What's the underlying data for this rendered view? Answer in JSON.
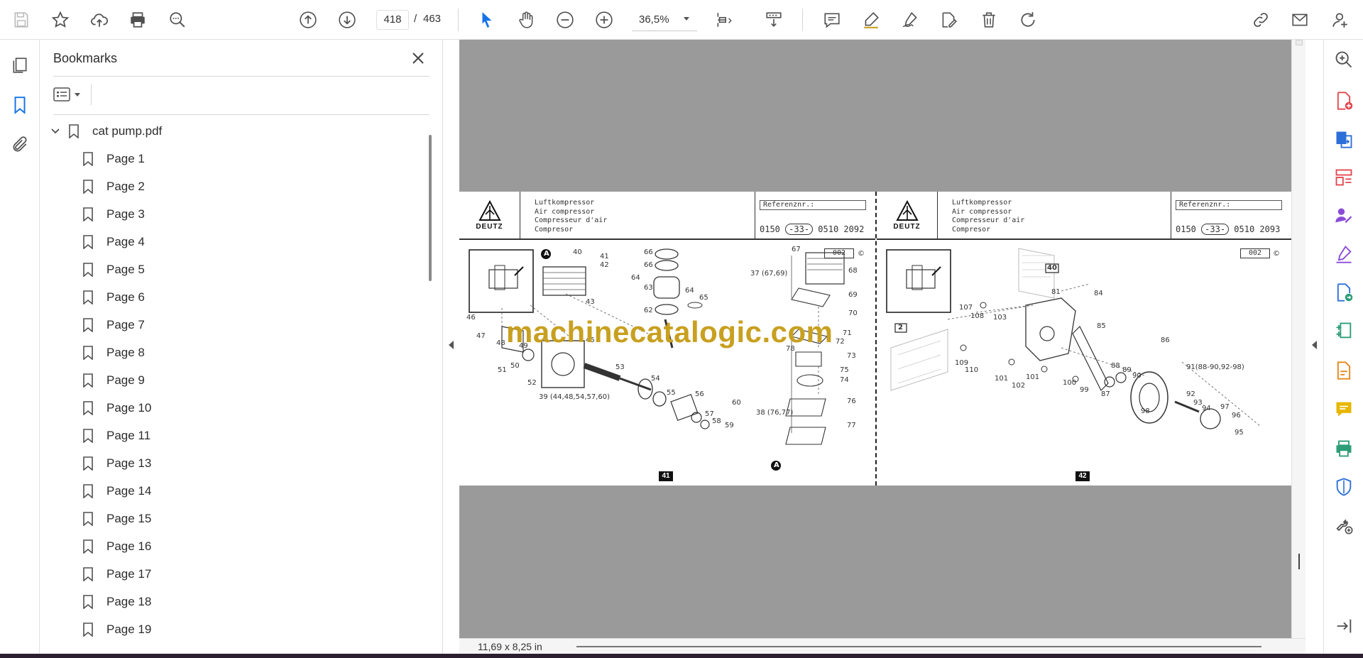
{
  "toolbar": {
    "page_current": "418",
    "page_separator": "/",
    "page_total": "463",
    "zoom": "36,5%",
    "icons": [
      "save-icon",
      "star-icon",
      "upload-icon",
      "print-icon",
      "search-zoom-icon",
      "prev-page-icon",
      "next-page-icon",
      "zoom-out-icon",
      "zoom-in-icon",
      "select-cursor-icon",
      "hand-icon",
      "fit-page-icon",
      "scroll-mode-icon",
      "comment-icon",
      "highlight-icon",
      "sign-icon",
      "edit-pdf-icon",
      "delete-icon",
      "rotate-icon",
      "share-link-icon",
      "email-icon",
      "account-icon"
    ]
  },
  "bookmarks": {
    "title": "Bookmarks",
    "root": "cat pump.pdf",
    "items": [
      "Page 1",
      "Page 2",
      "Page 3",
      "Page 4",
      "Page 5",
      "Page 6",
      "Page 7",
      "Page 8",
      "Page 9",
      "Page 10",
      "Page 11",
      "Page 13",
      "Page 14",
      "Page 15",
      "Page 16",
      "Page 17",
      "Page 18",
      "Page 19"
    ]
  },
  "document": {
    "left": {
      "brand": "DEUTZ",
      "titles": [
        "Luftkompressor",
        "Air compressor",
        "Compresseur d'air",
        "Compresor"
      ],
      "ref_label": "Referenznr.:",
      "ref_a": "0150",
      "ref_b": "-33-",
      "ref_c": "0510",
      "ref_d": "2092",
      "code": "002",
      "copyright": "©",
      "page_no": "41",
      "labels": [
        "40",
        "41",
        "42",
        "43",
        "45",
        "46",
        "47",
        "48",
        "49",
        "50",
        "51",
        "52",
        "53",
        "54",
        "55",
        "56",
        "57",
        "58",
        "59",
        "60",
        "62",
        "63",
        "64",
        "65",
        "66",
        "66",
        "64",
        "39 (44,48,54,57,60)",
        "67",
        "68",
        "69",
        "70",
        "71",
        "72",
        "73",
        "74",
        "75",
        "76",
        "77",
        "78",
        "37 (67,69)",
        "38 (76,77)",
        "A",
        "A"
      ]
    },
    "right": {
      "brand": "DEUTZ",
      "titles": [
        "Luftkompressor",
        "Air compressor",
        "Compresseur d'air",
        "Compresor"
      ],
      "ref_label": "Referenznr.:",
      "ref_a": "0150",
      "ref_b": "-33-",
      "ref_c": "0510",
      "ref_d": "2093",
      "code": "002",
      "copyright": "©",
      "page_no": "42",
      "labels": [
        "40",
        "2",
        "81",
        "84",
        "85",
        "86",
        "87",
        "88",
        "89",
        "90",
        "91(88-90,92-98)",
        "92",
        "93",
        "94",
        "95",
        "96",
        "97",
        "98",
        "99",
        "100",
        "101",
        "101",
        "102",
        "103",
        "107",
        "108",
        "109",
        "110"
      ]
    },
    "watermark": "machinecatalogic.com",
    "page_size": "11,69 x 8,25 in"
  },
  "right_rail": {
    "icons": [
      "zoom-search-icon",
      "create-pdf-icon",
      "export-pdf-icon",
      "organize-pages-icon",
      "request-signatures-icon",
      "fill-sign-icon",
      "send-review-icon",
      "compress-icon",
      "edit-document-icon",
      "comment-icon",
      "print-production-icon",
      "protect-icon",
      "more-tools-icon",
      "expand-panel-icon"
    ]
  },
  "colors": {
    "accent_blue": "#1473e6",
    "canvas_gray": "#9a9a9a",
    "watermark_gold": "#c8a020"
  }
}
